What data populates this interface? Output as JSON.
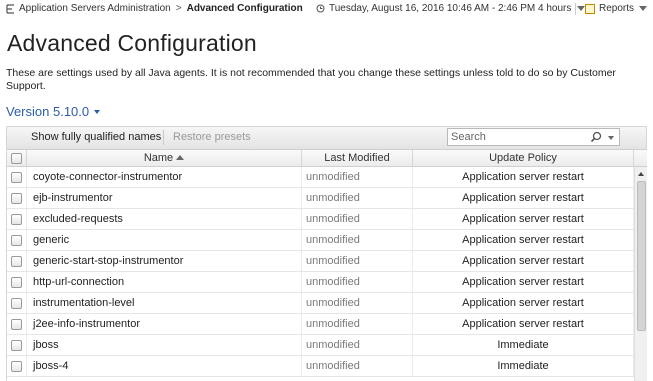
{
  "breadcrumb": {
    "parent": "Application Servers Administration",
    "separator": ">",
    "current": "Advanced Configuration"
  },
  "time_range": {
    "label": "Tuesday, August 16, 2016 10:46 AM - 2:46 PM 4 hours"
  },
  "reports": {
    "label": "Reports"
  },
  "page_title": "Advanced Configuration",
  "description": "These are settings used by all Java agents. It is not recommended that you change these settings unless told to do so by Customer Support.",
  "version": {
    "label": "Version 5.10.0"
  },
  "toolbar": {
    "show_fq_label": "Show fully qualified names",
    "restore_label": "Restore presets",
    "search_placeholder": "Search"
  },
  "table": {
    "columns": {
      "name": "Name",
      "last_modified": "Last Modified",
      "update_policy": "Update Policy"
    },
    "sort": {
      "column": "name",
      "direction": "ascending"
    },
    "rows": [
      {
        "name": "coyote-connector-instrumentor",
        "last_modified": "unmodified",
        "update_policy": "Application server restart"
      },
      {
        "name": "ejb-instrumentor",
        "last_modified": "unmodified",
        "update_policy": "Application server restart"
      },
      {
        "name": "excluded-requests",
        "last_modified": "unmodified",
        "update_policy": "Application server restart"
      },
      {
        "name": "generic",
        "last_modified": "unmodified",
        "update_policy": "Application server restart"
      },
      {
        "name": "generic-start-stop-instrumentor",
        "last_modified": "unmodified",
        "update_policy": "Application server restart"
      },
      {
        "name": "http-url-connection",
        "last_modified": "unmodified",
        "update_policy": "Application server restart"
      },
      {
        "name": "instrumentation-level",
        "last_modified": "unmodified",
        "update_policy": "Application server restart"
      },
      {
        "name": "j2ee-info-instrumentor",
        "last_modified": "unmodified",
        "update_policy": "Application server restart"
      },
      {
        "name": "jboss",
        "last_modified": "unmodified",
        "update_policy": "Immediate"
      },
      {
        "name": "jboss-4",
        "last_modified": "unmodified",
        "update_policy": "Immediate"
      }
    ]
  },
  "colors": {
    "link": "#2c5ea8",
    "muted_text": "#7a7a7a",
    "toolbar_bg": "#e4e4e4"
  },
  "icons": {
    "breadcrumb": "app-server-icon",
    "time": "clock-arrow-icon",
    "reports": "reports-icon",
    "search": "magnifier-icon"
  }
}
